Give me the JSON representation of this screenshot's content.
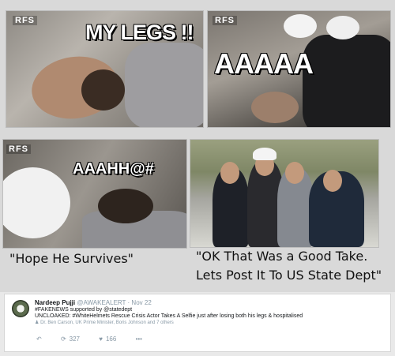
{
  "panels": {
    "watermark": "RFS",
    "panel1_text": "MY LEGS !!",
    "panel2_text": "AAAAA",
    "panel3_text": "AAAHH@#",
    "caption_left": "\"Hope He Survives\"",
    "caption_right_line1": "\"OK That Was a Good Take.",
    "caption_right_line2": "Lets Post It To US State Dept\""
  },
  "tweet": {
    "author_name": "Nardeep Pujji",
    "author_handle": "@AWAKEALERT",
    "date": "Nov 22",
    "line1": "#FAKENEWS supported by @statedept",
    "line2": "UNCLOAKED: #WhiteHelmets Rescue Crisis Actor Takes A Selfie just after losing both his legs & hospitalised",
    "likes_line": "Dr. Ben Carson, UK Prime Minister, Boris Johnson and 7 others",
    "reply_icon": "↶",
    "retweet_icon": "⟳",
    "retweet_count": "327",
    "like_icon": "♥",
    "like_count": "166",
    "more_icon": "•••"
  }
}
